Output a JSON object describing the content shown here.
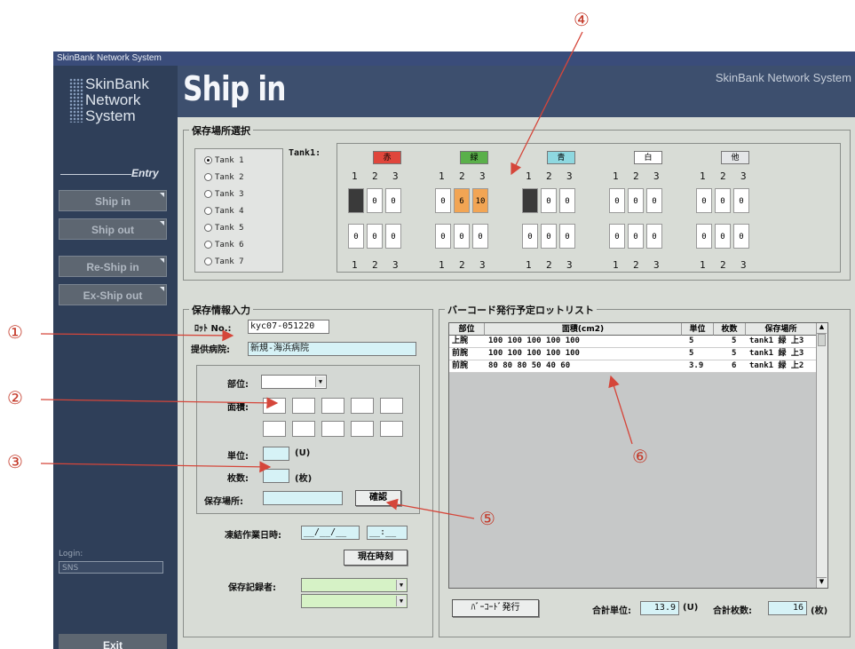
{
  "window_title": "SkinBank Network System",
  "sidebar": {
    "logo_lines": [
      "SkinBank",
      "Network",
      "System"
    ],
    "entry_label": "Entry",
    "nav": [
      "Ship in",
      "Ship out",
      "Re-Ship in",
      "Ex-Ship out"
    ],
    "login_label": "Login:",
    "login_value": "SNS",
    "exit_label": "Exit"
  },
  "header": {
    "title": "Ship in",
    "brand": "SkinBank Network System"
  },
  "storage": {
    "group_title": "保存場所選択",
    "tanks": [
      "Tank 1",
      "Tank 2",
      "Tank 3",
      "Tank 4",
      "Tank 5",
      "Tank 6",
      "Tank 7"
    ],
    "selected_tank": "Tank 1",
    "tank_label": "Tank1:",
    "colors": [
      {
        "label": "赤",
        "color": "#e0463c",
        "top": [
          "",
          "0",
          "0"
        ],
        "bottom": [
          "0",
          "0",
          "0"
        ],
        "dark": [
          true,
          false,
          false
        ],
        "orange": [
          false,
          false,
          false
        ]
      },
      {
        "label": "緑",
        "color": "#5ab04a",
        "top": [
          "0",
          "6",
          "10"
        ],
        "bottom": [
          "0",
          "0",
          "0"
        ],
        "dark": [
          false,
          false,
          false
        ],
        "orange": [
          false,
          true,
          true
        ]
      },
      {
        "label": "青",
        "color": "#8ed8e0",
        "top": [
          "",
          "0",
          "0"
        ],
        "bottom": [
          "0",
          "0",
          "0"
        ],
        "dark": [
          true,
          false,
          false
        ],
        "orange": [
          false,
          false,
          false
        ]
      },
      {
        "label": "白",
        "color": "#ffffff",
        "top": [
          "0",
          "0",
          "0"
        ],
        "bottom": [
          "0",
          "0",
          "0"
        ],
        "dark": [
          false,
          false,
          false
        ],
        "orange": [
          false,
          false,
          false
        ]
      },
      {
        "label": "他",
        "color": "#e4e6e8",
        "top": [
          "0",
          "0",
          "0"
        ],
        "bottom": [
          "0",
          "0",
          "0"
        ],
        "dark": [
          false,
          false,
          false
        ],
        "orange": [
          false,
          false,
          false
        ]
      }
    ],
    "col_numbers": [
      "1",
      "2",
      "3"
    ]
  },
  "info": {
    "group_title": "保存情報入力",
    "lot_label": "ﾛｯﾄ No.:",
    "lot_value": "kyc07-051220",
    "hospital_label": "提供病院:",
    "hospital_value": "新規-海浜病院",
    "part_label": "部位:",
    "area_label": "面積:",
    "unit_label": "単位:",
    "unit_suffix": "(U)",
    "count_label": "枚数:",
    "count_suffix": "(枚)",
    "place_label": "保存場所:",
    "confirm_label": "確認",
    "freeze_label": "凍結作業日時:",
    "date_value": "__/__/__",
    "time_value": "__:__",
    "now_button": "現在時刻",
    "recorder_label": "保存記録者:"
  },
  "lotlist": {
    "group_title": "バーコード発行予定ロットリスト",
    "columns": [
      "部位",
      "面積(cm2)",
      "単位",
      "枚数",
      "保存場所"
    ],
    "rows": [
      {
        "part": "上腕",
        "area": "100 100 100 100 100",
        "unit": "5",
        "count": "5",
        "place": "tank1 緑 上3"
      },
      {
        "part": "前腕",
        "area": "100 100 100 100 100",
        "unit": "5",
        "count": "5",
        "place": "tank1 緑 上3"
      },
      {
        "part": "前腕",
        "area": "80 80 80 50 40 60",
        "unit": "3.9",
        "count": "6",
        "place": "tank1 緑 上2"
      }
    ],
    "barcode_button": "ﾊﾞｰｺｰﾄﾞ発行",
    "total_unit_label": "合計単位:",
    "total_unit_value": "13.9",
    "total_unit_suffix": "(U)",
    "total_count_label": "合計枚数:",
    "total_count_value": "16",
    "total_count_suffix": "(枚)"
  },
  "annotations": [
    "①",
    "②",
    "③",
    "④",
    "⑤",
    "⑥"
  ],
  "annotation_color": "#c43a2a"
}
